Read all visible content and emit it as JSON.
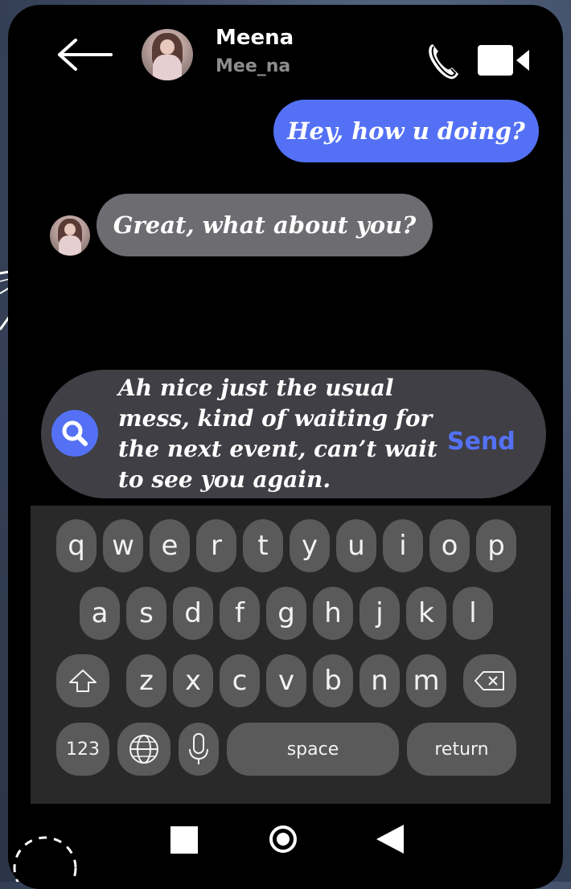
{
  "contact": {
    "name": "Meena",
    "handle": "Mee_na"
  },
  "messages": [
    {
      "direction": "sent",
      "text": "Hey, how u doing?"
    },
    {
      "direction": "received",
      "text": "Great, what about you?"
    }
  ],
  "composer": {
    "text": "Ah nice just the usual\nmess, kind of waiting for\nthe next event, can’t wait\nto see you again.",
    "send_label": "Send"
  },
  "keyboard": {
    "row1": [
      "q",
      "w",
      "e",
      "r",
      "t",
      "y",
      "u",
      "i",
      "o",
      "p"
    ],
    "row2": [
      "a",
      "s",
      "d",
      "f",
      "g",
      "h",
      "j",
      "k",
      "l"
    ],
    "row3": [
      "z",
      "x",
      "c",
      "v",
      "b",
      "n",
      "m"
    ],
    "numbers_label": "123",
    "space_label": "space",
    "return_label": "return"
  },
  "icons": {
    "back": "arrow-left-icon",
    "call": "phone-icon",
    "video": "video-camera-icon",
    "search": "search-icon",
    "shift": "shift-icon",
    "delete": "backspace-icon",
    "globe": "globe-icon",
    "mic": "microphone-icon",
    "nav_recent": "square-icon",
    "nav_home": "circle-icon",
    "nav_back": "triangle-icon"
  },
  "colors": {
    "accent": "#5471f5",
    "received_bubble": "#6d6c70",
    "composer_bg": "#3f3f45",
    "keyboard_bg": "#292929",
    "key_bg": "#5a5a5a"
  }
}
